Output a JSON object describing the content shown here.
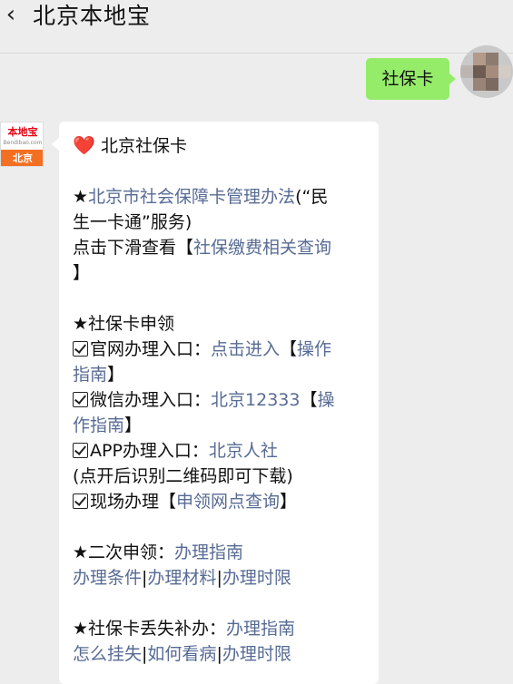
{
  "header": {
    "back_icon": "chevron-left-icon",
    "title": "北京本地宝"
  },
  "user_message": {
    "text": "社保卡"
  },
  "bot_avatar": {
    "logo_text": "本地宝",
    "logo_sub": "Bendibao.com",
    "city": "北京"
  },
  "bot_message": {
    "heading_icon": "heart-icon",
    "heading": "北京社保卡",
    "s1": {
      "star": "★",
      "link1": "北京市社会保障卡管理办法",
      "text1": "(“民",
      "text2": "生一卡通”服务)",
      "text3": "点击下滑查看【",
      "link2": "社保缴费相关查询",
      "text4": "】"
    },
    "s2": {
      "heading": "★社保卡申领",
      "r1_label": "官网办理入口：",
      "r1_link": "点击进入",
      "r1_bracket": "【",
      "r1_link2a": "操作",
      "r1_link2b": "指南",
      "r1_end": "】",
      "r2_label": "微信办理入口：",
      "r2_link": "北京12333",
      "r2_bracket": "【",
      "r2_link2a": "操",
      "r2_link2b": "作指南",
      "r2_end": "】",
      "r3_label": "APP办理入口：",
      "r3_link": "北京人社",
      "r3_note": "(点开后识别二维码即可下载)",
      "r4_label": "现场办理【",
      "r4_link": "申领网点查询",
      "r4_end": "】"
    },
    "s3": {
      "label": "★二次申领：",
      "link": "办理指南",
      "links": [
        "办理条件",
        "办理材料",
        "办理时限"
      ],
      "sep": "|"
    },
    "s4": {
      "label": "★社保卡丢失补办：",
      "link": "办理指南",
      "links": [
        "怎么挂失",
        "如何看病",
        "办理时限"
      ],
      "sep": "|"
    }
  }
}
